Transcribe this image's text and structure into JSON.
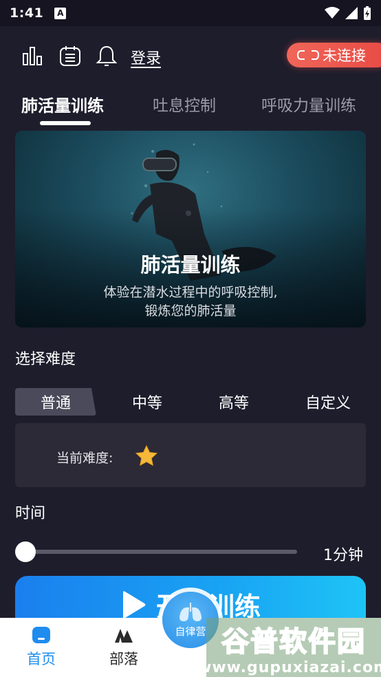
{
  "status_bar": {
    "time": "1:41",
    "notification_glyph": "A"
  },
  "header": {
    "login_label": "登录",
    "connection_status": "未连接"
  },
  "tabs": [
    {
      "label": "肺活量训练",
      "active": true
    },
    {
      "label": "吐息控制",
      "active": false
    },
    {
      "label": "呼吸力量训练",
      "active": false
    }
  ],
  "banner": {
    "title": "肺活量训练",
    "desc_line1": "体验在潜水过程中的呼吸控制,",
    "desc_line2": "锻炼您的肺活量"
  },
  "difficulty": {
    "section_label": "选择难度",
    "options": [
      "普通",
      "中等",
      "高等",
      "自定义"
    ],
    "selected": "普通",
    "current_label": "当前难度:",
    "current_stars": 1
  },
  "time": {
    "section_label": "时间",
    "value_label": "1分钟",
    "slider_fraction": 0.0
  },
  "start_button": {
    "label": "开始训练"
  },
  "bottom_nav": {
    "items": [
      {
        "label": "首页",
        "icon": "home-icon",
        "active": true
      },
      {
        "label": "部落",
        "icon": "tribe-icon",
        "active": false
      }
    ],
    "center_label": "自律营"
  },
  "watermark": {
    "title": "谷普软件园",
    "url": "www.gupuxiazai.com"
  },
  "colors": {
    "accent_blue": "#1f8cf0",
    "connect_red": "#e84a44",
    "background": "#1e1d2c"
  }
}
